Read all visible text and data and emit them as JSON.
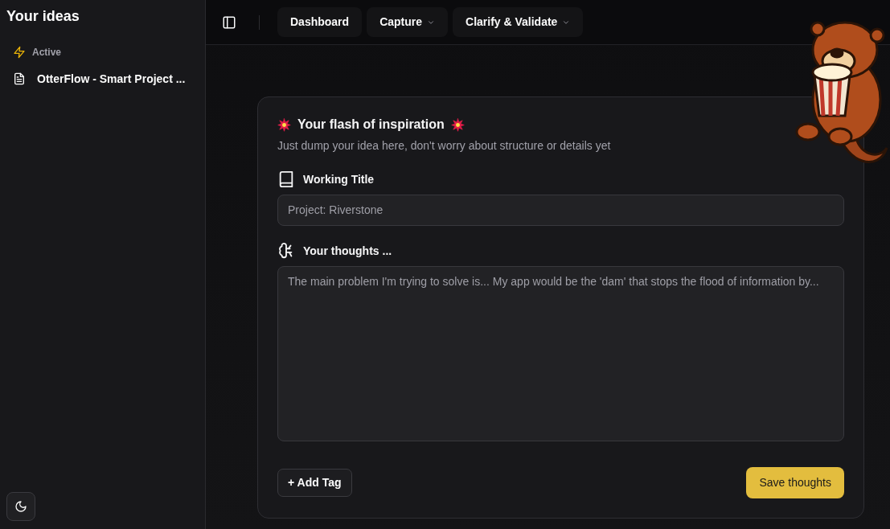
{
  "sidebar": {
    "title": "Your ideas",
    "sections": [
      {
        "label": "Active",
        "items": [
          {
            "label": "OtterFlow - Smart Project ...",
            "selected": false
          }
        ]
      }
    ]
  },
  "topbar": {
    "nav": [
      {
        "label": "Dashboard",
        "kind": "link"
      },
      {
        "label": "Capture",
        "kind": "dropdown"
      },
      {
        "label": "Clarify & Validate",
        "kind": "dropdown"
      }
    ]
  },
  "card": {
    "title": "Your flash of inspiration",
    "subtitle": "Just dump your idea here, don't worry about structure or details yet",
    "fields": [
      {
        "kind": "input",
        "label": "Working Title",
        "placeholder": "Project: Riverstone"
      },
      {
        "kind": "textarea",
        "label": "Your thoughts ...",
        "placeholder": "The main problem I'm trying to solve is... My app would be the 'dam' that stops the flood of information by..."
      }
    ],
    "tag_button": "+ Add Tag",
    "save_button": "Save thoughts"
  }
}
